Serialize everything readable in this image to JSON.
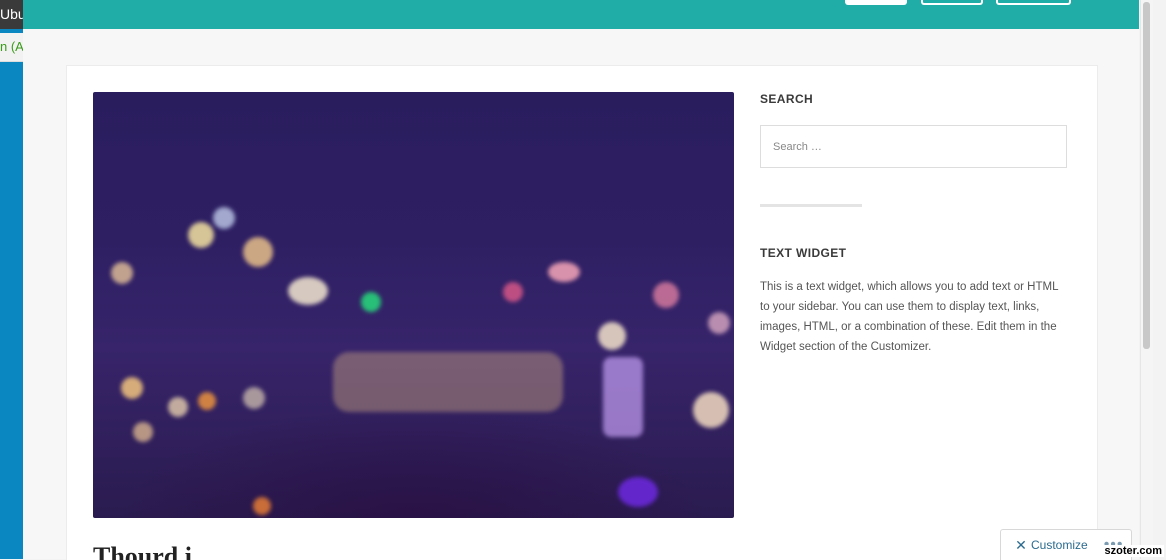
{
  "desktop": {
    "top_fragment": "Ubur",
    "tab_fragment": "n (Au"
  },
  "sidebar": {
    "search_title": "SEARCH",
    "search_placeholder": "Search …",
    "text_widget_title": "TEXT WIDGET",
    "text_widget_body": "This is a text widget, which allows you to add text or HTML to your sidebar. You can use them to display text, links, images, HTML, or a combination of these. Edit them in the Widget section of the Customizer."
  },
  "post": {
    "title_fragment": "Thourd i"
  },
  "customize": {
    "label": "Customize",
    "icon": "wrench-screwdriver-icon"
  },
  "watermark": "szoter.com",
  "colors": {
    "header": "#20ada8",
    "desktop_blue": "#0a86c1"
  }
}
